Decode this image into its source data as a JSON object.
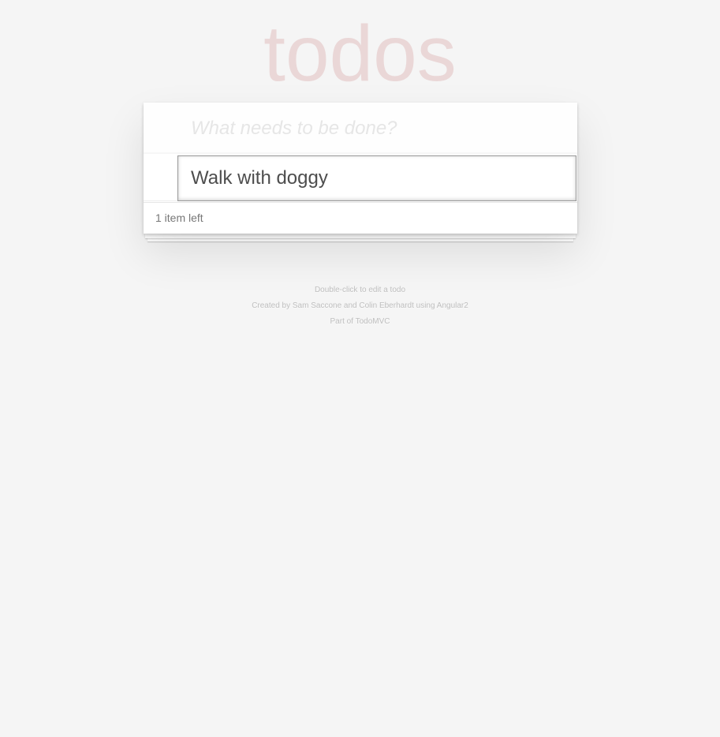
{
  "header": {
    "title": "todos"
  },
  "new_todo": {
    "placeholder": "What needs to be done?",
    "value": ""
  },
  "todos": [
    {
      "title": "Walk with doggy",
      "editing": true
    }
  ],
  "footer": {
    "count_text": "1 item left"
  },
  "info": {
    "hint": "Double-click to edit a todo",
    "credits": "Created by Sam Saccone and Colin Eberhardt using Angular2",
    "part_of": "Part of TodoMVC"
  },
  "colors": {
    "background": "#f5f5f5",
    "title": "#efd5d5",
    "card": "#ffffff",
    "text": "#4d4d4d",
    "info_text": "#bfbfbf"
  }
}
